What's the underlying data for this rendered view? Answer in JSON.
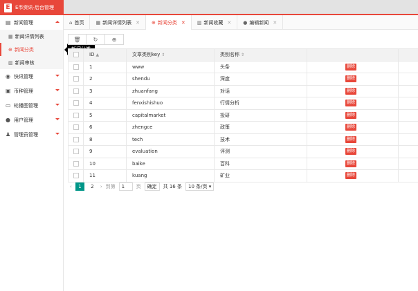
{
  "brand": {
    "logo_letter": "E",
    "title": "E币资讯-后台管理"
  },
  "sidebar": {
    "groups": [
      {
        "label": "新闻管理",
        "icon": "doc-icon",
        "expanded": true,
        "items": [
          {
            "label": "新闻详情列表",
            "active": false
          },
          {
            "label": "新闻分类",
            "active": true
          },
          {
            "label": "新闻审核",
            "active": false
          }
        ]
      },
      {
        "label": "快讯管理",
        "icon": "eye-icon"
      },
      {
        "label": "币种管理",
        "icon": "bank-icon"
      },
      {
        "label": "轮播图管理",
        "icon": "image-icon"
      },
      {
        "label": "用户管理",
        "icon": "user-circle-icon"
      },
      {
        "label": "管理员管理",
        "icon": "admin-icon"
      }
    ]
  },
  "tooltip": "新闻分类",
  "tabs": [
    {
      "label": "首页",
      "closable": false,
      "active": false
    },
    {
      "label": "新闻详情列表",
      "closable": true,
      "active": false
    },
    {
      "label": "新闻分类",
      "closable": true,
      "active": true
    },
    {
      "label": "新闻收藏",
      "closable": true,
      "active": false
    },
    {
      "label": "编辑新闻",
      "closable": true,
      "active": false
    }
  ],
  "table": {
    "headers": {
      "id": "ID",
      "key": "文章类别key",
      "name": "类别名称"
    },
    "delete_label": "删除",
    "rows": [
      {
        "id": "1",
        "key": "www",
        "name": "头条"
      },
      {
        "id": "2",
        "key": "shendu",
        "name": "深度"
      },
      {
        "id": "3",
        "key": "zhuanfang",
        "name": "对话"
      },
      {
        "id": "4",
        "key": "fenxishishuo",
        "name": "行情分析"
      },
      {
        "id": "5",
        "key": "capitalmarket",
        "name": "投研"
      },
      {
        "id": "6",
        "key": "zhengce",
        "name": "政策"
      },
      {
        "id": "8",
        "key": "tech",
        "name": "技术"
      },
      {
        "id": "9",
        "key": "evaluation",
        "name": "评测"
      },
      {
        "id": "10",
        "key": "baike",
        "name": "百科"
      },
      {
        "id": "11",
        "key": "kuang",
        "name": "矿业"
      }
    ]
  },
  "pager": {
    "prev": "‹",
    "next": "›",
    "pages": [
      "1",
      "2"
    ],
    "current": "1",
    "goto_label": "到第",
    "goto_value": "1",
    "page_unit": "页",
    "confirm": "确定",
    "total": "共 16 条",
    "page_size": "10 条/页"
  },
  "colors": {
    "brand": "#e8473a",
    "pager_active": "#009688"
  }
}
